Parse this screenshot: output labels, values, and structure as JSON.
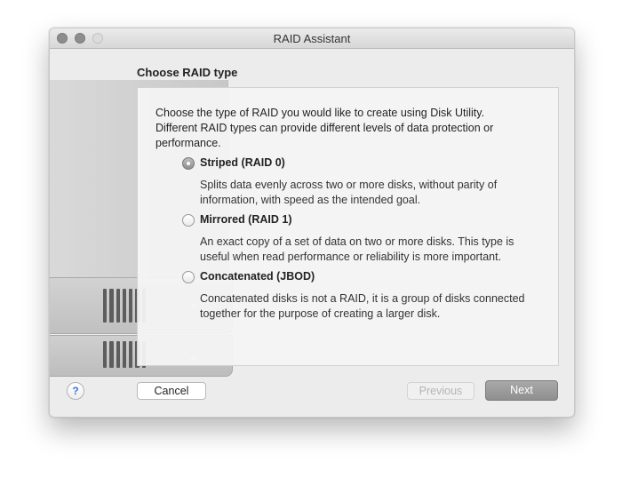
{
  "window": {
    "title": "RAID Assistant"
  },
  "section_title": "Choose RAID type",
  "description": "Choose the type of RAID you would like to create using Disk Utility. Different RAID types can provide different levels of data protection or performance.",
  "options": [
    {
      "label": "Striped (RAID 0)",
      "description": "Splits data evenly across two or more disks, without parity of information, with speed as the intended goal.",
      "selected": true
    },
    {
      "label": "Mirrored (RAID 1)",
      "description": "An exact copy of a set of data on two or more disks. This type is useful when read performance or reliability is more important.",
      "selected": false
    },
    {
      "label": "Concatenated (JBOD)",
      "description": "Concatenated disks is not a RAID, it is a group of disks connected together for the purpose of creating a larger disk.",
      "selected": false
    }
  ],
  "buttons": {
    "help": "?",
    "cancel": "Cancel",
    "previous": "Previous",
    "next": "Next"
  },
  "icons": {
    "window_controls": [
      "close-icon",
      "minimize-icon",
      "zoom-icon"
    ],
    "help": "question-mark-icon",
    "illustration": "hard-drive-icon"
  },
  "colors": {
    "help_accent": "#3b78d8",
    "next_button": "#9c9c9c"
  }
}
